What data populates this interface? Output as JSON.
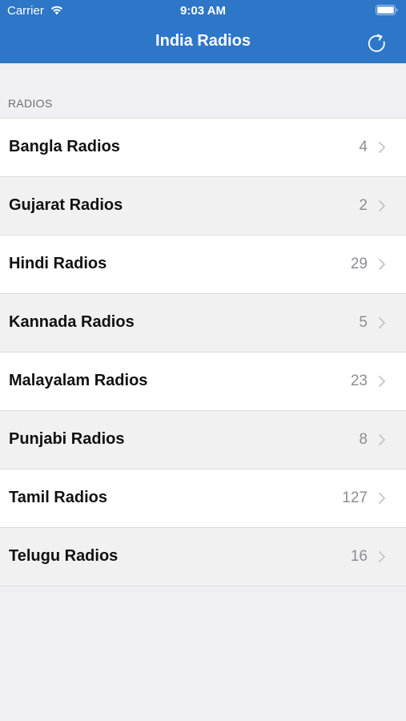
{
  "status_bar": {
    "carrier": "Carrier",
    "time": "9:03 AM",
    "wifi_icon": "wifi-icon",
    "battery_icon": "battery-icon"
  },
  "nav": {
    "title": "India Radios",
    "refresh_icon": "refresh-icon"
  },
  "section": {
    "header": "RADIOS"
  },
  "items": [
    {
      "label": "Bangla Radios",
      "count": "4"
    },
    {
      "label": "Gujarat Radios",
      "count": "2"
    },
    {
      "label": "Hindi Radios",
      "count": "29"
    },
    {
      "label": "Kannada Radios",
      "count": "5"
    },
    {
      "label": "Malayalam Radios",
      "count": "23"
    },
    {
      "label": "Punjabi Radios",
      "count": "8"
    },
    {
      "label": "Tamil Radios",
      "count": "127"
    },
    {
      "label": "Telugu Radios",
      "count": "16"
    }
  ],
  "colors": {
    "nav_bar": "#2d76c8",
    "background": "#efeff4",
    "row_white": "#ffffff",
    "row_grey": "#f1f1f2",
    "count_text": "#8e8e93"
  }
}
